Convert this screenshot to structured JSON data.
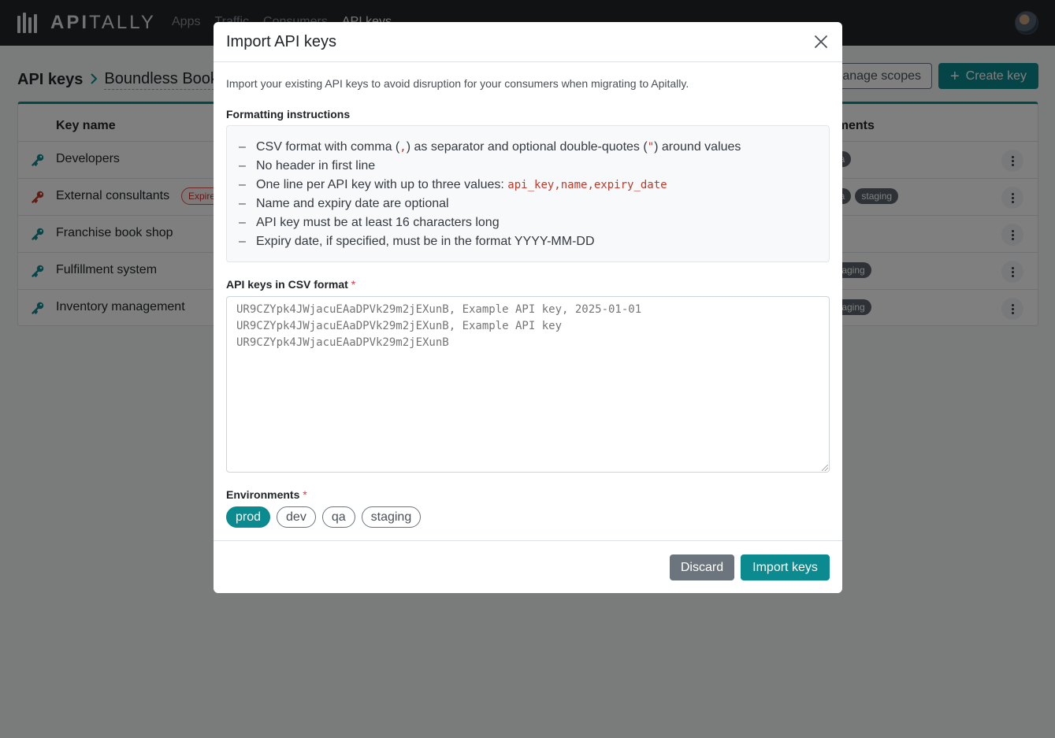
{
  "app": {
    "brand_strong": "API",
    "brand_light": "TALLY"
  },
  "nav": {
    "items": [
      "Apps",
      "Traffic",
      "Consumers",
      "API keys"
    ]
  },
  "page": {
    "breadcrumb_root": "API keys",
    "breadcrumb_app": "Boundless Book",
    "manage_scopes_label": "anage scopes",
    "create_key_label": "Create key"
  },
  "table": {
    "columns": {
      "key_name": "Key name",
      "environments": "nments"
    },
    "rows": [
      {
        "name": "Developers",
        "badge": "",
        "envs": [
          "qa"
        ],
        "key_color": "#0b8a8f"
      },
      {
        "name": "External consultants",
        "badge": "Expire",
        "envs": [
          "qa",
          "staging"
        ],
        "key_color": "#c0392b"
      },
      {
        "name": "Franchise book shop",
        "badge": "",
        "envs": [],
        "key_color": "#0b8a8f"
      },
      {
        "name": "Fulfillment system",
        "badge": "",
        "envs": [
          "staging"
        ],
        "key_color": "#0b8a8f"
      },
      {
        "name": "Inventory management",
        "badge": "",
        "envs": [
          "staging"
        ],
        "key_color": "#0b8a8f"
      }
    ]
  },
  "modal": {
    "title": "Import API keys",
    "intro": "Import your existing API keys to avoid disruption for your consumers when migrating to Apitally.",
    "instructions_label": "Formatting instructions",
    "instructions": {
      "line1_a": "CSV format with comma (",
      "line1_comma": ",",
      "line1_b": ") as separator and optional double-quotes (",
      "line1_quote": "\"",
      "line1_c": ") around values",
      "line2": "No header in first line",
      "line3_a": "One line per API key with up to three values: ",
      "line3_code": "api_key,name,expiry_date",
      "line4": "Name and expiry date are optional",
      "line5": "API key must be at least 16 characters long",
      "line6": "Expiry date, if specified, must be in the format YYYY-MM-DD"
    },
    "csv_label": "API keys in CSV format",
    "required_mark": "*",
    "csv_placeholder": "UR9CZYpk4JWjacuEAaDPVk29m2jEXunB, Example API key, 2025-01-01\nUR9CZYpk4JWjacuEAaDPVk29m2jEXunB, Example API key\nUR9CZYpk4JWjacuEAaDPVk29m2jEXunB",
    "environments_label": "Environments",
    "environments": [
      {
        "label": "prod",
        "selected": true
      },
      {
        "label": "dev",
        "selected": false
      },
      {
        "label": "qa",
        "selected": false
      },
      {
        "label": "staging",
        "selected": false
      }
    ],
    "discard_label": "Discard",
    "import_label": "Import keys"
  },
  "colors": {
    "accent": "#0b8a8f",
    "danger": "#dc3545",
    "navbar": "#212529"
  }
}
